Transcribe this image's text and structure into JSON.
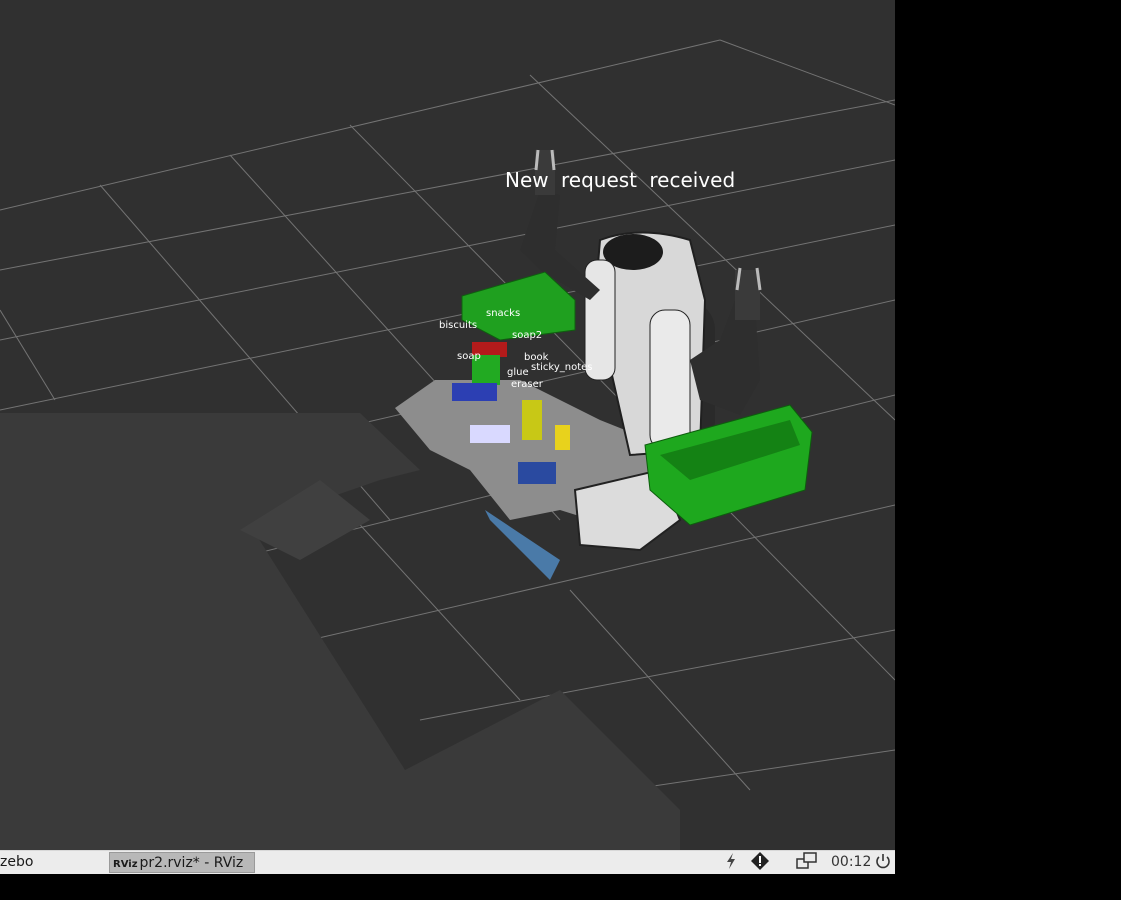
{
  "viewport": {
    "banner": "New  request  received",
    "object_labels": {
      "snacks": "snacks",
      "biscuits": "biscuits",
      "soap2": "soap2",
      "soap": "soap",
      "book": "book",
      "sticky_notes": "sticky_notes",
      "glue": "glue",
      "eraser": "eraser"
    }
  },
  "taskbar": {
    "tasks": [
      {
        "label": "zebo"
      },
      {
        "label": "pr2.rviz* - RViz",
        "icon": "RViz"
      }
    ],
    "tray": {
      "power_status_icon": "lightning-icon",
      "warning_icon": "warning-icon",
      "windows_icon": "windows-icon",
      "clock": "00:12",
      "shutdown_icon": "power-icon"
    }
  },
  "colors": {
    "background": "#303030",
    "grid": "#9a9a9a",
    "bin_green": "#1fa01f",
    "taskbar": "#ececec"
  }
}
